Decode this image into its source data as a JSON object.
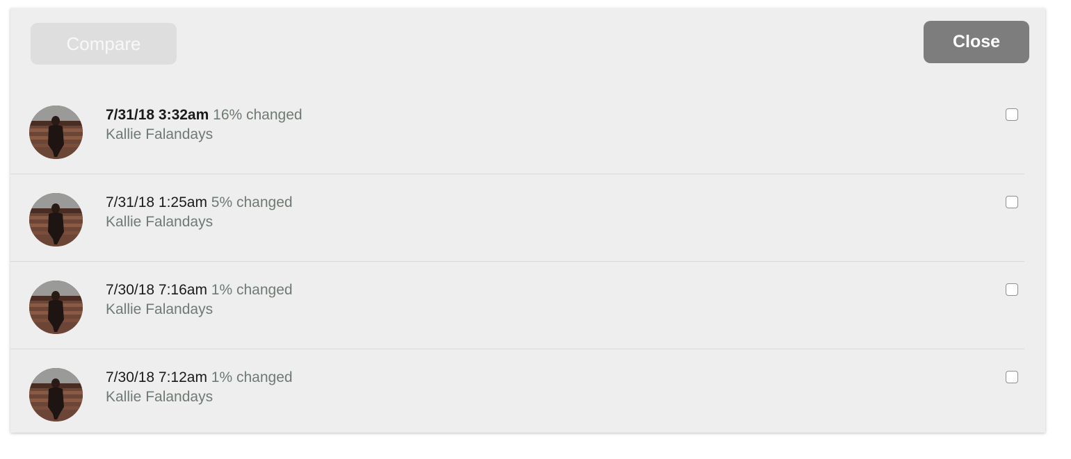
{
  "toolbar": {
    "compare_label": "Compare",
    "close_label": "Close"
  },
  "revisions": [
    {
      "date": "7/31/18 3:32am",
      "change": "16% changed",
      "author": "Kallie Falandays",
      "current": true,
      "checked": false
    },
    {
      "date": "7/31/18 1:25am",
      "change": "5% changed",
      "author": "Kallie Falandays",
      "current": false,
      "checked": false
    },
    {
      "date": "7/30/18 7:16am",
      "change": "1% changed",
      "author": "Kallie Falandays",
      "current": false,
      "checked": false
    },
    {
      "date": "7/30/18 7:12am",
      "change": "1% changed",
      "author": "Kallie Falandays",
      "current": false,
      "checked": false
    }
  ],
  "colors": {
    "panel_bg": "#eeeeee",
    "close_button_bg": "#7d7d7d",
    "compare_button_bg_disabled": "#dedede",
    "meta_text": "#6e7a72"
  }
}
